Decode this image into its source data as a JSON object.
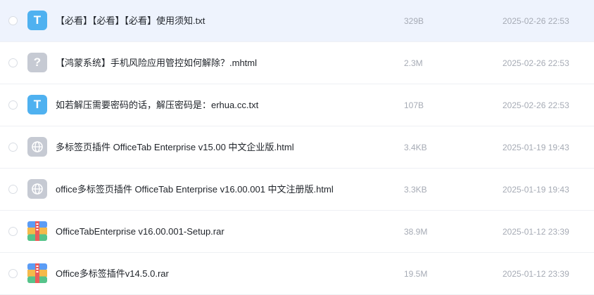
{
  "files": [
    {
      "name": "【必看】【必看】【必看】使用须知.txt",
      "size": "329B",
      "date": "2025-02-26 22:53",
      "icon": "txt-file-icon",
      "glyph": "T"
    },
    {
      "name": "【鸿蒙系统】手机风险应用管控如何解除？.mhtml",
      "size": "2.3M",
      "date": "2025-02-26 22:53",
      "icon": "unknown-file-icon",
      "glyph": "?"
    },
    {
      "name": "如若解压需要密码的话，解压密码是：erhua.cc.txt",
      "size": "107B",
      "date": "2025-02-26 22:53",
      "icon": "txt-file-icon",
      "glyph": "T"
    },
    {
      "name": "多标签页插件 OfficeTab Enterprise v15.00 中文企业版.html",
      "size": "3.4KB",
      "date": "2025-01-19 19:43",
      "icon": "html-file-icon"
    },
    {
      "name": "office多标签页插件 OfficeTab Enterprise v16.00.001 中文注册版.html",
      "size": "3.3KB",
      "date": "2025-01-19 19:43",
      "icon": "html-file-icon"
    },
    {
      "name": "OfficeTabEnterprise v16.00.001-Setup.rar",
      "size": "38.9M",
      "date": "2025-01-12 23:39",
      "icon": "rar-file-icon"
    },
    {
      "name": "Office多标签插件v14.5.0.rar",
      "size": "19.5M",
      "date": "2025-01-12 23:39",
      "icon": "rar-file-icon"
    }
  ],
  "colors": {
    "selected_row": "#eef3fd",
    "txt_icon": "#4fb1f0",
    "muted_icon": "#c6cad3"
  }
}
